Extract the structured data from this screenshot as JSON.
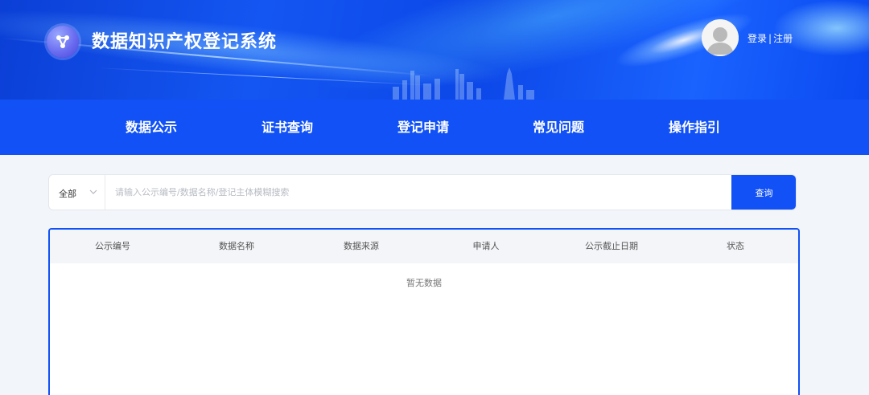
{
  "header": {
    "title": "数据知识产权登记系统",
    "logo_icon": "share-nodes-icon",
    "avatar_icon": "user-avatar-icon",
    "login_label": "登录",
    "separator": "|",
    "register_label": "注册"
  },
  "nav": {
    "items": [
      {
        "label": "数据公示"
      },
      {
        "label": "证书查询"
      },
      {
        "label": "登记申请"
      },
      {
        "label": "常见问题"
      },
      {
        "label": "操作指引"
      }
    ]
  },
  "search": {
    "filter_value": "全部",
    "placeholder": "请输入公示编号/数据名称/登记主体模糊搜索",
    "button_label": "查询"
  },
  "table": {
    "columns": [
      "公示编号",
      "数据名称",
      "数据来源",
      "申请人",
      "公示截止日期",
      "状态"
    ],
    "empty_text": "暂无数据"
  },
  "colors": {
    "primary": "#1151f5",
    "page_bg": "#f2f5f9",
    "table_header_bg": "#f3f5f8"
  }
}
